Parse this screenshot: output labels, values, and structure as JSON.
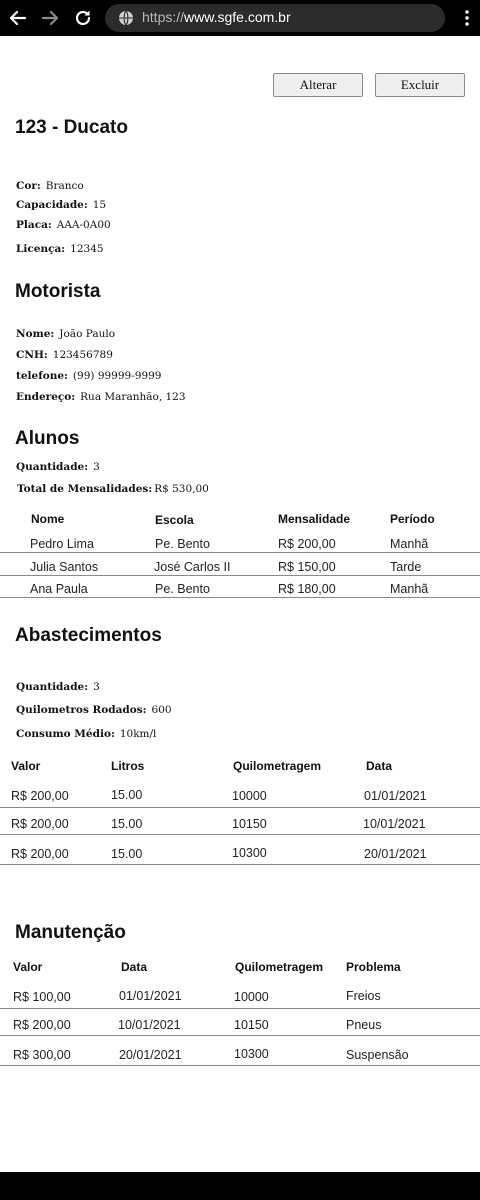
{
  "browser": {
    "url_prefix": "https://",
    "url_host": "www.sgfe.com.br"
  },
  "actions": {
    "edit_label": "Alterar",
    "delete_label": "Excluir"
  },
  "vehicle": {
    "title": "123 - Ducato",
    "color_label": "Cor:",
    "color_value": "Branco",
    "capacity_label": "Capacidade:",
    "capacity_value": "15",
    "plate_label": "Placa:",
    "plate_value": "AAA-0A00",
    "license_label": "Licença:",
    "license_value": "12345"
  },
  "driver": {
    "heading": "Motorista",
    "name_label": "Nome:",
    "name_value": "João Paulo",
    "cnh_label": "CNH:",
    "cnh_value": "123456789",
    "phone_label": "telefone:",
    "phone_value": "(99) 99999-9999",
    "address_label": "Endereço:",
    "address_value": "Rua Maranhão, 123"
  },
  "students": {
    "heading": "Alunos",
    "qty_label": "Quantidade:",
    "qty_value": "3",
    "total_label": "Total de Mensalidades:",
    "total_value": "R$ 530,00",
    "columns": [
      "Nome",
      "Escola",
      "Mensalidade",
      "Período"
    ],
    "rows": [
      [
        "Pedro Lima",
        "Pe. Bento",
        "R$ 200,00",
        "Manhã"
      ],
      [
        "Julia Santos",
        "José Carlos II",
        "R$ 150,00",
        "Tarde"
      ],
      [
        "Ana Paula",
        "Pe. Bento",
        "R$ 180,00",
        "Manhã"
      ]
    ]
  },
  "fueling": {
    "heading": "Abastecimentos",
    "qty_label": "Quantidade:",
    "qty_value": "3",
    "km_label": "Quilometros Rodados:",
    "km_value": "600",
    "consumption_label": "Consumo Médio:",
    "consumption_value": "10km/l",
    "columns": [
      "Valor",
      "Litros",
      "Quilometragem",
      "Data"
    ],
    "rows": [
      [
        "R$ 200,00",
        "15.00",
        "10000",
        "01/01/2021"
      ],
      [
        "R$ 200,00",
        "15.00",
        "10150",
        "10/01/2021"
      ],
      [
        "R$ 200,00",
        "15.00",
        "10300",
        "20/01/2021"
      ]
    ]
  },
  "maintenance": {
    "heading": "Manutenção",
    "columns": [
      "Valor",
      "Data",
      "Quilometragem",
      "Problema"
    ],
    "rows": [
      [
        "R$ 100,00",
        "01/01/2021",
        "10000",
        "Freios"
      ],
      [
        "R$ 200,00",
        "10/01/2021",
        "10150",
        "Pneus"
      ],
      [
        "R$ 300,00",
        "20/01/2021",
        "10300",
        "Suspensão"
      ]
    ]
  }
}
